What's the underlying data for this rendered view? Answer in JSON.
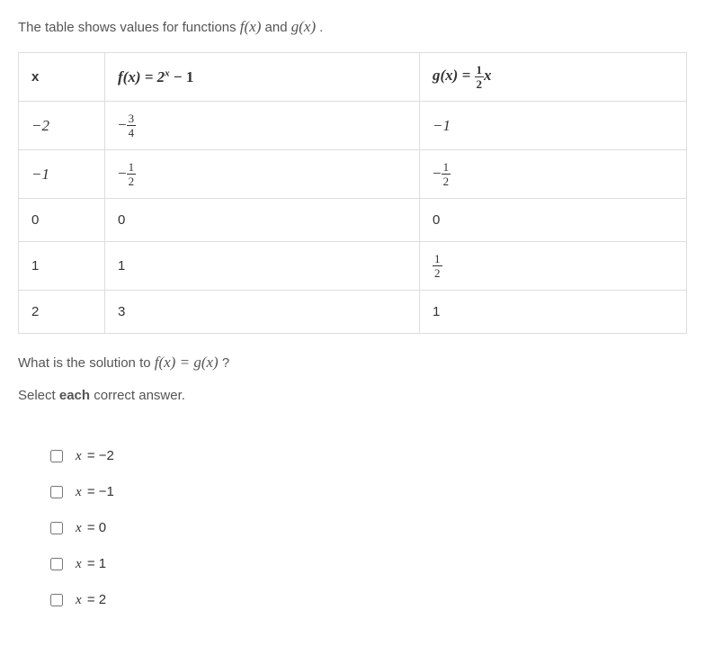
{
  "intro": {
    "prefix": "The table shows values for functions ",
    "f": "f(x)",
    "and": " and ",
    "g": "g(x)",
    "suffix": " ."
  },
  "headers": {
    "x": "x"
  },
  "fheader": {
    "label": "f(x) = 2",
    "exp": "x",
    "tail": " − 1"
  },
  "gheader": {
    "label": "g(x) = ",
    "fracnum": "1",
    "fracden": "2",
    "tail": "x"
  },
  "rows": {
    "r0": {
      "x": "−2",
      "f_neg": "−",
      "f_num": "3",
      "f_den": "4",
      "g": "−1"
    },
    "r1": {
      "x": "−1",
      "f_neg": "−",
      "f_num": "1",
      "f_den": "2",
      "g_neg": "−",
      "g_num": "1",
      "g_den": "2"
    },
    "r2": {
      "x": "0",
      "f": "0",
      "g": "0"
    },
    "r3": {
      "x": "1",
      "f": "1",
      "g_num": "1",
      "g_den": "2"
    },
    "r4": {
      "x": "2",
      "f": "3",
      "g": "1"
    }
  },
  "question": {
    "prefix": "What is the solution to ",
    "eq": "f(x) = g(x)",
    "suffix": " ?"
  },
  "instruct": {
    "p1": "Select ",
    "p2": "each",
    "p3": " correct answer."
  },
  "choices": {
    "c0": {
      "var": "x",
      "rest": " = −2"
    },
    "c1": {
      "var": "x",
      "rest": " = −1"
    },
    "c2": {
      "var": "x",
      "rest": " = 0"
    },
    "c3": {
      "var": "x",
      "rest": " = 1"
    },
    "c4": {
      "var": "x",
      "rest": " = 2"
    }
  }
}
